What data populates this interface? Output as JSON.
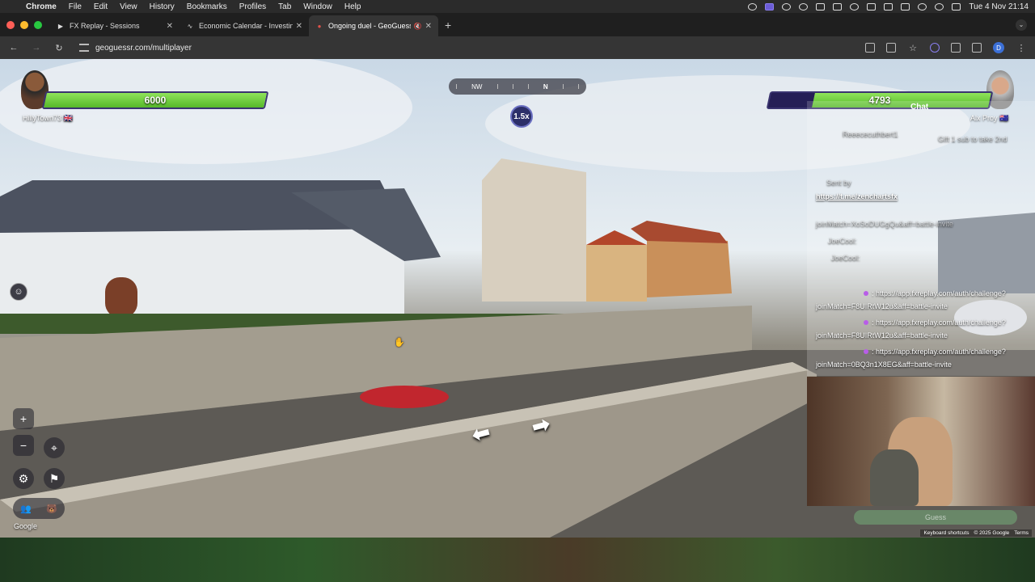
{
  "menubar": {
    "app": "Chrome",
    "items": [
      "File",
      "Edit",
      "View",
      "History",
      "Bookmarks",
      "Profiles",
      "Tab",
      "Window",
      "Help"
    ],
    "clock": "Tue 4 Nov  21:14"
  },
  "tabs": [
    {
      "title": "FX Replay - Sessions",
      "active": false
    },
    {
      "title": "Economic Calendar - Investing",
      "active": false
    },
    {
      "title": "Ongoing duel - GeoGuessr",
      "active": true
    }
  ],
  "toolbar": {
    "url": "geoguessr.com/multiplayer",
    "profile_initial": "D"
  },
  "game": {
    "player_left": {
      "name": "HillyTown73",
      "flag": "🇬🇧",
      "health": "6000",
      "health_fraction": 1.0
    },
    "player_right": {
      "name": "Alx Proy",
      "flag": "🇦🇺",
      "health": "4793",
      "health_fraction": 0.8
    },
    "compass": {
      "left": "NW",
      "center": "N"
    },
    "zoom": "1.5x",
    "google": "Google",
    "footer_links": [
      "Keyboard shortcuts",
      "© 2025 Google",
      "Terms"
    ]
  },
  "chat": {
    "title": "Chat",
    "lines": [
      {
        "text": "Reeececuthbert1",
        "faded": true
      },
      {
        "text": "Gift 1 sub to take 2nd",
        "faded": true
      },
      {
        "text": "Sent by",
        "faded": true
      },
      {
        "text": "https://t.me/zenchartsfx",
        "link": true
      },
      {
        "text": "joinMatch=XoSoDUGgQu&aff=battle-invite",
        "faded": true
      },
      {
        "text": "JoeCool:",
        "faded": true
      },
      {
        "text": "JoeCool:",
        "faded": true
      },
      {
        "text": ": https://app.fxreplay.com/auth/challenge?"
      },
      {
        "text": "joinMatch=F8UIRtW12u&aff=battle-invite"
      },
      {
        "text": ": https://app.fxreplay.com/auth/challenge?"
      },
      {
        "text": "joinMatch=F8UIRtW12u&aff=battle-invite"
      },
      {
        "text": ": https://app.fxreplay.com/auth/challenge?"
      },
      {
        "text": "joinMatch=0BQ3n1X8EG&aff=battle-invite"
      }
    ]
  },
  "guess_button": "Guess",
  "colors": {
    "health_green": "#7fd64a",
    "health_empty": "#251f56",
    "accent_purple": "#6b5cd6"
  }
}
